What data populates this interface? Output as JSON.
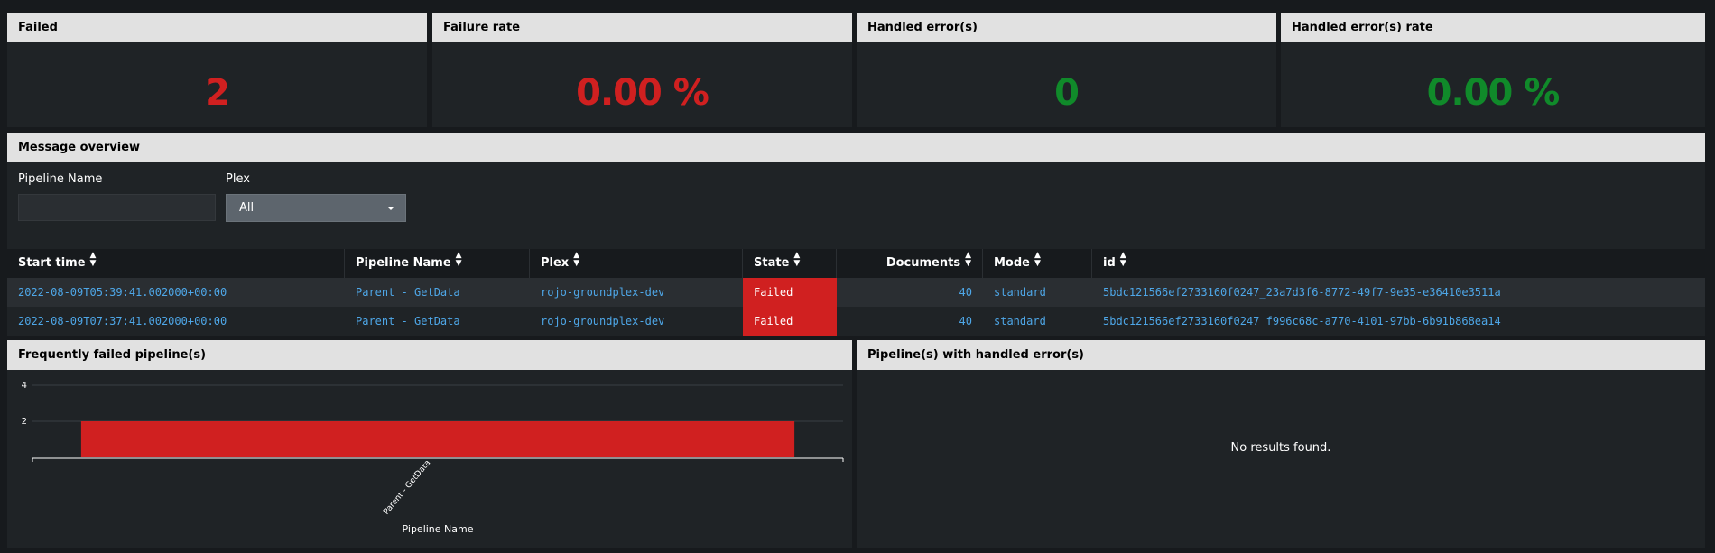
{
  "colors": {
    "failure_red": "#d02020",
    "success_green": "#108a2a",
    "link_blue": "#4ea7e8",
    "panel_header_bg": "#e1e1e1",
    "panel_bg": "#1f2326"
  },
  "kpis": [
    {
      "title": "Failed",
      "value": "2",
      "tone": "red"
    },
    {
      "title": "Failure rate",
      "value": "0.00 %",
      "tone": "red"
    },
    {
      "title": "Handled error(s)",
      "value": "0",
      "tone": "green"
    },
    {
      "title": "Handled error(s) rate",
      "value": "0.00 %",
      "tone": "green"
    }
  ],
  "message_overview": {
    "title": "Message overview",
    "filters": {
      "pipeline_name_label": "Pipeline Name",
      "pipeline_name_value": "",
      "plex_label": "Plex",
      "plex_selected": "All"
    },
    "table": {
      "columns": [
        "Start time",
        "Pipeline Name",
        "Plex",
        "State",
        "Documents",
        "Mode",
        "id"
      ],
      "rows": [
        {
          "start_time": "2022-08-09T05:39:41.002000+00:00",
          "pipeline_name": "Parent - GetData",
          "plex": "rojo-groundplex-dev",
          "state": "Failed",
          "documents": "40",
          "mode": "standard",
          "id": "5bdc121566ef2733160f0247_23a7d3f6-8772-49f7-9e35-e36410e3511a"
        },
        {
          "start_time": "2022-08-09T07:37:41.002000+00:00",
          "pipeline_name": "Parent - GetData",
          "plex": "rojo-groundplex-dev",
          "state": "Failed",
          "documents": "40",
          "mode": "standard",
          "id": "5bdc121566ef2733160f0247_f996c68c-a770-4101-97bb-6b91b868ea14"
        }
      ]
    }
  },
  "frequent_failed": {
    "title": "Frequently failed pipeline(s)",
    "chart_data": {
      "type": "bar",
      "categories": [
        "Parent - GetData"
      ],
      "values": [
        2
      ],
      "xlabel": "Pipeline Name",
      "ylabel": "",
      "yticks": [
        2,
        4
      ],
      "ylim": [
        0,
        4
      ],
      "grid": true,
      "bar_color": "#d02020"
    }
  },
  "handled_errors": {
    "title": "Pipeline(s) with handled error(s)",
    "empty_text": "No results found."
  }
}
